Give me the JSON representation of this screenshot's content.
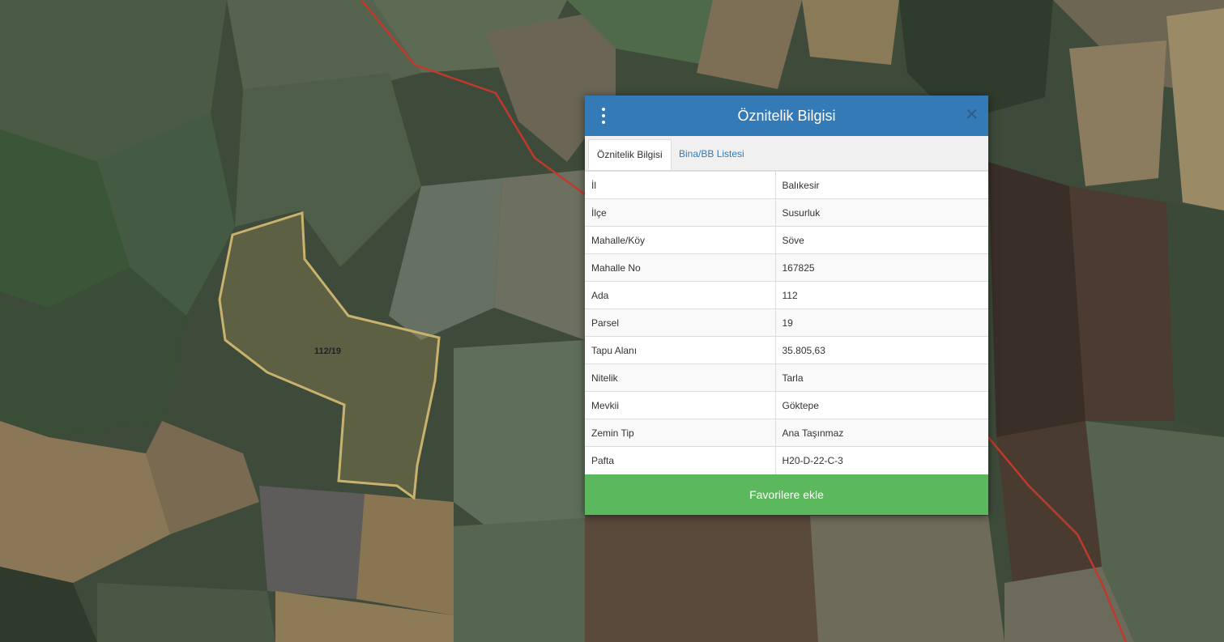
{
  "map": {
    "parcel_label": "112/19",
    "colors": {
      "parcel_outline": "#c9b26e",
      "boundary_line": "#c0392b"
    }
  },
  "dialog": {
    "title": "Öznitelik Bilgisi",
    "close_glyph": "✕",
    "tabs": [
      {
        "label": "Öznitelik Bilgisi",
        "active": true
      },
      {
        "label": "Bina/BB Listesi",
        "active": false
      }
    ],
    "rows": [
      {
        "key": "İl",
        "value": "Balıkesir"
      },
      {
        "key": "İlçe",
        "value": "Susurluk"
      },
      {
        "key": "Mahalle/Köy",
        "value": "Söve"
      },
      {
        "key": "Mahalle No",
        "value": "167825"
      },
      {
        "key": "Ada",
        "value": "112"
      },
      {
        "key": "Parsel",
        "value": "19"
      },
      {
        "key": "Tapu Alanı",
        "value": "35.805,63"
      },
      {
        "key": "Nitelik",
        "value": "Tarla"
      },
      {
        "key": "Mevkii",
        "value": "Göktepe"
      },
      {
        "key": "Zemin Tip",
        "value": "Ana Taşınmaz"
      },
      {
        "key": "Pafta",
        "value": "H20-D-22-C-3"
      }
    ],
    "favorite_button": "Favorilere ekle",
    "colors": {
      "header": "#337ab7",
      "favorite": "#5cb85c",
      "tab_link": "#337ab7"
    }
  }
}
